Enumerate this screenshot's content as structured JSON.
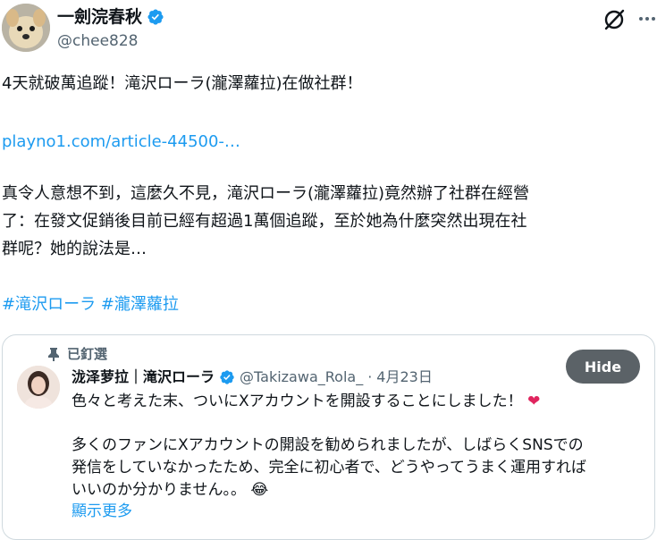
{
  "author": {
    "display_name": "一劍浣春秋",
    "handle": "@chee828",
    "verified": true
  },
  "tweet": {
    "line1": "4天就破萬追蹤！滝沢ローラ(瀧澤蘿拉)在做社群！",
    "link": "playno1.com/article-44500-…",
    "body_line1": "真令人意想不到，這麼久不見，滝沢ローラ(瀧澤蘿拉)竟然辦了社群在經營",
    "body_line2": "了：在發文促銷後目前已經有超過1萬個追蹤，至於她為什麼突然出現在社",
    "body_line3": "群呢？她的說法是…",
    "hashtag1": "#滝沢ローラ",
    "hashtag2": "#瀧澤蘿拉"
  },
  "quote": {
    "pinned_label": "已釘選",
    "display_name": "泷泽萝拉｜滝沢ローラ",
    "handle": "@Takizawa_Rola_",
    "separator": "·",
    "date": "4月23日",
    "hide_label": "Hide",
    "line1": "色々と考えた末、ついにXアカウントを開設することにしました！",
    "line1_emoji": "❤",
    "line2": "多くのファンにXアカウントの開設を勧められましたが、しばらくSNSでの",
    "line3": "発信をしていなかったため、完全に初心者で、どうやってうまく運用すれば",
    "line4": "いいのか分かりません。。",
    "line4_emoji": "😂",
    "show_more": "顯示更多"
  },
  "icons": {
    "verified": "verified-badge-icon",
    "grok": "grok-icon",
    "more": "more-icon",
    "pin": "pin-icon"
  },
  "colors": {
    "link": "#1d9bf0",
    "verified": "#1d9bf0",
    "hide_button": "#5b6267"
  }
}
